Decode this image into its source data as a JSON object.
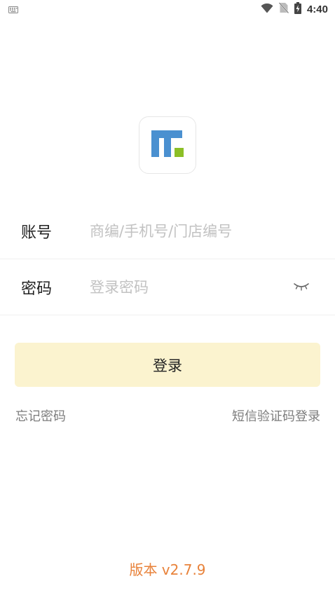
{
  "status_bar": {
    "time": "4:40",
    "icons": [
      "keyboard-icon",
      "wifi-icon",
      "no-sim-icon",
      "battery-charging-icon"
    ]
  },
  "logo": {
    "icon": "app-logo-icon",
    "colors": {
      "blue": "#4a90d0",
      "green": "#8cbf26"
    }
  },
  "form": {
    "account": {
      "label": "账号",
      "placeholder": "商编/手机号/门店编号",
      "value": ""
    },
    "password": {
      "label": "密码",
      "placeholder": "登录密码",
      "value": "",
      "toggle_icon": "eye-closed-icon"
    }
  },
  "login_button": {
    "label": "登录",
    "color": "#fbf3cf"
  },
  "links": {
    "forgot_password": "忘记密码",
    "sms_login": "短信验证码登录"
  },
  "version": {
    "text": "版本 v2.7.9",
    "color": "#e8823a"
  }
}
